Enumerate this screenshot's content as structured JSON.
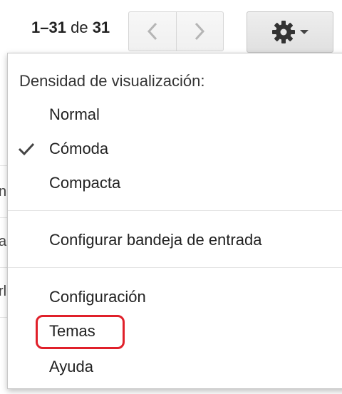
{
  "toolbar": {
    "pager_range": "1–31",
    "pager_of": "de",
    "pager_total": "31",
    "prev_icon": "chevron-left-icon",
    "next_icon": "chevron-right-icon",
    "settings_icon": "gear-icon"
  },
  "menu": {
    "density_heading": "Densidad de visualización:",
    "density_options": [
      {
        "label": "Normal",
        "checked": false
      },
      {
        "label": "Cómoda",
        "checked": true
      },
      {
        "label": "Compacta",
        "checked": false
      }
    ],
    "configure_inbox": "Configurar bandeja de entrada",
    "settings": "Configuración",
    "themes": "Temas",
    "help": "Ayuda"
  },
  "background": {
    "frag1": "n",
    "frag2": "a",
    "frag3": "rl"
  },
  "colors": {
    "highlight": "#e0202a",
    "menu_border": "#c8c8c8",
    "button_bg": "#e6e6e6"
  }
}
